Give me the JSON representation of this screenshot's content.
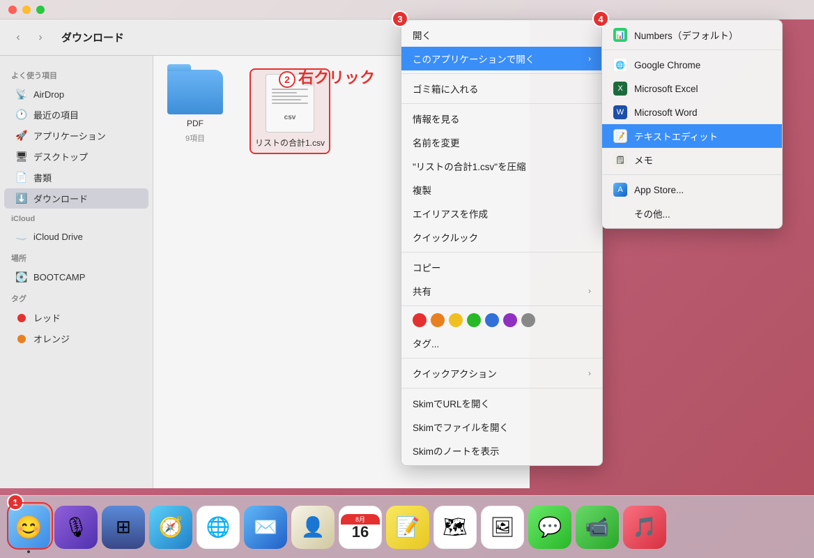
{
  "titlebar": {
    "traffic": [
      "red",
      "yellow",
      "green"
    ]
  },
  "sidebar": {
    "favorites_label": "よく使う項目",
    "items": [
      {
        "label": "AirDrop",
        "icon": "📡"
      },
      {
        "label": "最近の項目",
        "icon": "🕐"
      },
      {
        "label": "アプリケーション",
        "icon": "🚀"
      },
      {
        "label": "デスクトップ",
        "icon": "🖥"
      },
      {
        "label": "書類",
        "icon": "📄"
      },
      {
        "label": "ダウンロード",
        "icon": "⬇️"
      }
    ],
    "icloud_label": "iCloud",
    "icloud_items": [
      {
        "label": "iCloud Drive",
        "icon": "☁️"
      }
    ],
    "places_label": "場所",
    "places_items": [
      {
        "label": "BOOTCAMP",
        "icon": "💽"
      }
    ],
    "tags_label": "タグ",
    "tags_items": [
      {
        "label": "レッド",
        "color": "#e53030"
      },
      {
        "label": "オレンジ",
        "color": "#e88020"
      }
    ]
  },
  "finder": {
    "title": "ダウンロード",
    "folder": {
      "name": "PDF",
      "sub": "9項目"
    },
    "file": {
      "name": "リストの合計1.csv"
    }
  },
  "step_labels": {
    "s1": "1",
    "s2": "2",
    "s3": "3",
    "s4": "4",
    "right_click": "右クリック"
  },
  "context_menu": {
    "open": "開く",
    "open_with": "このアプリケーションで開く",
    "trash": "ゴミ箱に入れる",
    "info": "情報を見る",
    "rename": "名前を変更",
    "compress": "\"リストの合計1.csv\"を圧縮",
    "duplicate": "複製",
    "alias": "エイリアスを作成",
    "quicklook": "クイックルック",
    "copy": "コピー",
    "share": "共有",
    "tags_menu": "タグ...",
    "quick_actions": "クイックアクション",
    "skim_url": "SkimでURLを開く",
    "skim_file": "Skimでファイルを開く",
    "skim_notes": "Skimのノートを表示",
    "tags": [
      "red",
      "orange",
      "yellow",
      "green",
      "blue",
      "purple",
      "gray"
    ]
  },
  "submenu": {
    "numbers": "Numbers（デフォルト）",
    "chrome": "Google Chrome",
    "excel": "Microsoft Excel",
    "word": "Microsoft Word",
    "textedit": "テキストエディット",
    "memo": "メモ",
    "appstore": "App Store...",
    "other": "その他..."
  },
  "dock": {
    "items": [
      {
        "label": "Finder",
        "icon": "😊"
      },
      {
        "label": "Siri",
        "icon": "🎙"
      },
      {
        "label": "Launchpad",
        "icon": "⬛"
      },
      {
        "label": "Safari",
        "icon": "🧭"
      },
      {
        "label": "Chrome",
        "icon": "🌐"
      },
      {
        "label": "Mail",
        "icon": "✉️"
      },
      {
        "label": "Contacts",
        "icon": "👤"
      },
      {
        "label": "Calendar",
        "icon": "📅"
      },
      {
        "label": "Notes",
        "icon": "📝"
      },
      {
        "label": "Maps",
        "icon": "🗺"
      },
      {
        "label": "Photos",
        "icon": "🖼"
      },
      {
        "label": "Messages",
        "icon": "💬"
      },
      {
        "label": "FaceTime",
        "icon": "📹"
      },
      {
        "label": "Music",
        "icon": "🎵"
      }
    ],
    "date_num": "16",
    "date_mon": "8月"
  },
  "colors": {
    "accent": "#3a8ef8",
    "danger": "#e53030",
    "sidebar_bg": "#eaeaea",
    "menu_bg": "#f5f5f5"
  }
}
